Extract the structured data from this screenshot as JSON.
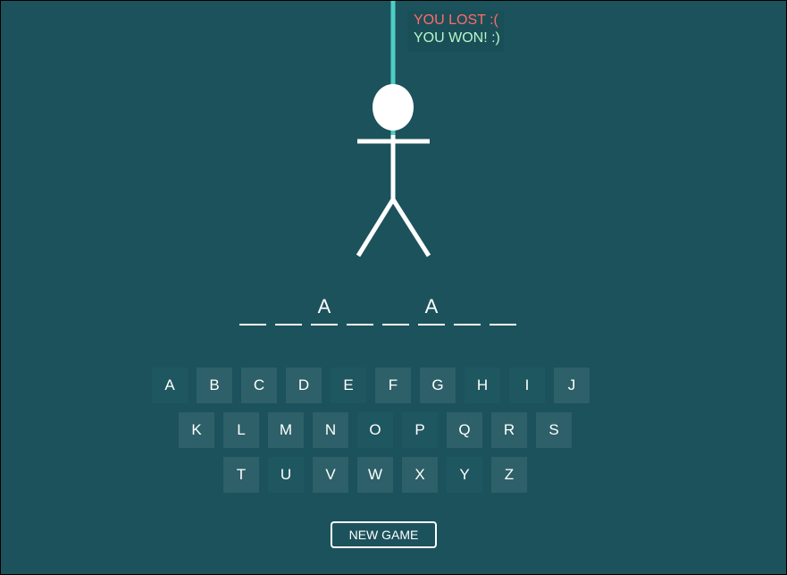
{
  "status": {
    "lost_text": "YOU LOST :(",
    "won_text": "YOU WON! :)"
  },
  "colors": {
    "background": "#1c525c",
    "rope": "#4ecdc4",
    "figure": "#ffffff",
    "key": "#2d6068",
    "key_used": "#1f5760",
    "lost": "#ff6b6b",
    "won": "#b9f6ca"
  },
  "word": {
    "slots": [
      "",
      "",
      "A",
      "",
      "",
      "A",
      "",
      ""
    ]
  },
  "keyboard": {
    "rows": [
      [
        {
          "letter": "A",
          "used": true
        },
        {
          "letter": "B",
          "used": false
        },
        {
          "letter": "C",
          "used": false
        },
        {
          "letter": "D",
          "used": false
        },
        {
          "letter": "E",
          "used": true
        },
        {
          "letter": "F",
          "used": false
        },
        {
          "letter": "G",
          "used": false
        },
        {
          "letter": "H",
          "used": true
        },
        {
          "letter": "I",
          "used": true
        },
        {
          "letter": "J",
          "used": false
        }
      ],
      [
        {
          "letter": "K",
          "used": false
        },
        {
          "letter": "L",
          "used": false
        },
        {
          "letter": "M",
          "used": false
        },
        {
          "letter": "N",
          "used": false
        },
        {
          "letter": "O",
          "used": true
        },
        {
          "letter": "P",
          "used": true
        },
        {
          "letter": "Q",
          "used": false
        },
        {
          "letter": "R",
          "used": false
        },
        {
          "letter": "S",
          "used": false
        }
      ],
      [
        {
          "letter": "T",
          "used": false
        },
        {
          "letter": "U",
          "used": true
        },
        {
          "letter": "V",
          "used": false
        },
        {
          "letter": "W",
          "used": false
        },
        {
          "letter": "X",
          "used": false
        },
        {
          "letter": "Y",
          "used": true
        },
        {
          "letter": "Z",
          "used": false
        }
      ]
    ]
  },
  "new_game_label": "NEW GAME"
}
